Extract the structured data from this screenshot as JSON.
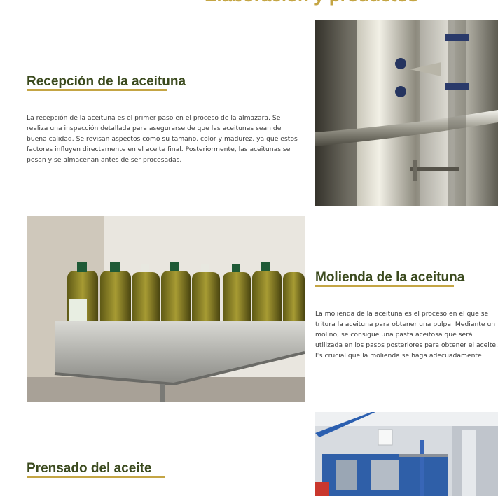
{
  "page": {
    "heading": "Elaboración y productos"
  },
  "sections": [
    {
      "title": "Recepción de la aceituna",
      "text": "La recepción de la aceituna es el primer paso en el proceso de la almazara. Se realiza una inspección detallada para asegurarse de que las aceitunas sean de buena calidad. Se revisan aspectos como su tamaño, color y madurez, ya que estos factores influyen directamente en el aceite final. Posteriormente, las aceitunas se pesan y se almacenan antes de ser procesadas.",
      "image": "stainless-steel-pipes-photo"
    },
    {
      "title": "Molienda de la aceituna",
      "text": "La molienda de la aceituna es el proceso en el que se tritura la aceituna para obtener una pulpa. Mediante un molino, se consigue una pasta aceitosa que será utilizada en los pasos posteriores para obtener el aceite. Es crucial que la molienda se haga adecuadamente para preservar los componentes del aceite, garantizando la calidad del producto final. Este paso es esencial para obtener un aceite puro y con todas sus propiedades.",
      "image": "olive-oil-bottles-photo"
    },
    {
      "title": "Prensado del aceite",
      "text": "",
      "image": "factory-machinery-photo"
    }
  ],
  "colors": {
    "accent": "#c4a544",
    "title": "#3b4a1e",
    "text": "#3a3a3a"
  }
}
